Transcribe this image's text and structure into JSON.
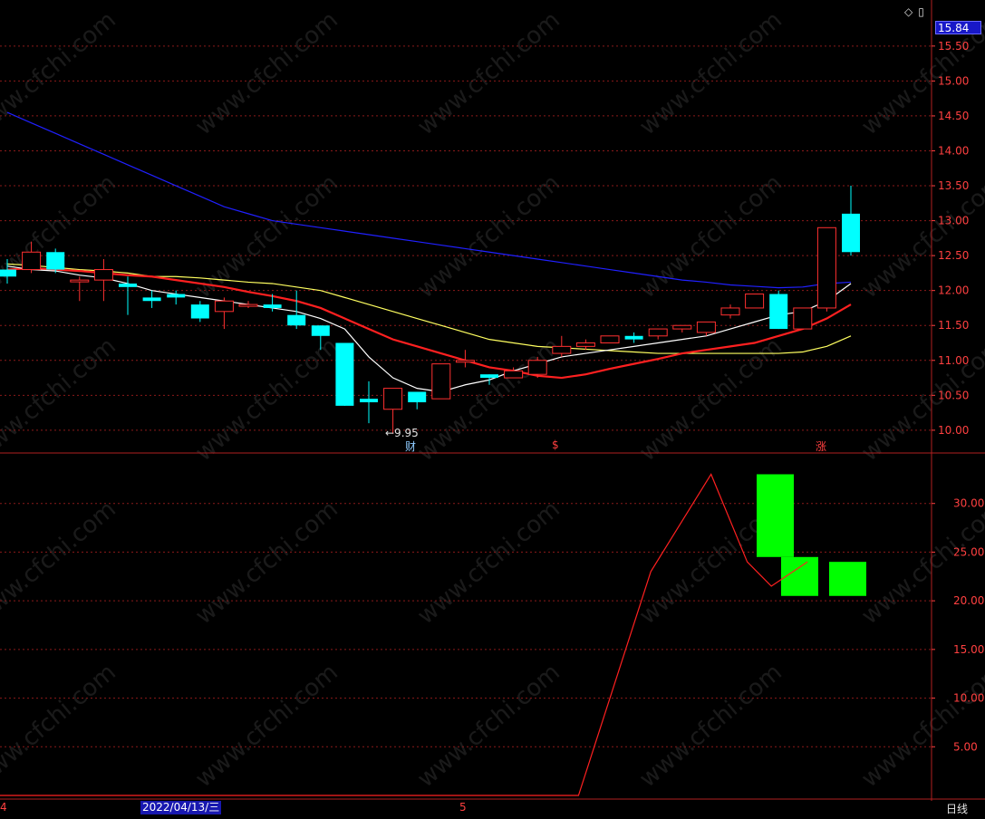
{
  "header": {
    "current_price": "15.84",
    "icons": [
      "diamond-icon",
      "window-restore-icon"
    ]
  },
  "footer": {
    "left_tick": "4",
    "date_badge": "2022/04/13/三",
    "mid_tick": "5",
    "period": "日线"
  },
  "events": {
    "cai": "财",
    "s": "$",
    "zhang": "涨"
  },
  "annotations": {
    "low_label": "←9.95"
  },
  "watermark": "www.cfchi.com",
  "colors": {
    "background": "#000000",
    "up": "#ff3030",
    "down": "#00ffff",
    "grid": "#8b1a1a",
    "ma5": "#ffffff",
    "ma10": "#ff2020",
    "ma20": "#ffff60",
    "ma60": "#2020ff",
    "volume_bar": "#00ff00",
    "volume_line": "#ff2020"
  },
  "chart_data": [
    {
      "type": "candlestick",
      "y_ticks": [
        "10.00",
        "10.50",
        "11.00",
        "11.50",
        "12.00",
        "12.50",
        "13.00",
        "13.50",
        "14.00",
        "14.50",
        "15.00",
        "15.50"
      ],
      "ylim": [
        9.7,
        15.9
      ],
      "candles": [
        {
          "o": 12.3,
          "c": 12.2,
          "h": 12.45,
          "l": 12.1
        },
        {
          "o": 12.3,
          "c": 12.55,
          "h": 12.7,
          "l": 12.25
        },
        {
          "o": 12.55,
          "c": 12.3,
          "h": 12.6,
          "l": 12.25
        },
        {
          "o": 12.15,
          "c": 12.15,
          "h": 12.2,
          "l": 11.85
        },
        {
          "o": 12.15,
          "c": 12.3,
          "h": 12.45,
          "l": 11.85
        },
        {
          "o": 12.1,
          "c": 12.05,
          "h": 12.2,
          "l": 11.65
        },
        {
          "o": 11.9,
          "c": 11.85,
          "h": 12.0,
          "l": 11.75
        },
        {
          "o": 11.95,
          "c": 11.9,
          "h": 12.0,
          "l": 11.8
        },
        {
          "o": 11.8,
          "c": 11.6,
          "h": 11.85,
          "l": 11.55
        },
        {
          "o": 11.7,
          "c": 11.85,
          "h": 11.9,
          "l": 11.45
        },
        {
          "o": 11.8,
          "c": 11.8,
          "h": 11.85,
          "l": 11.75
        },
        {
          "o": 11.8,
          "c": 11.75,
          "h": 11.95,
          "l": 11.7
        },
        {
          "o": 11.65,
          "c": 11.5,
          "h": 12.0,
          "l": 11.45
        },
        {
          "o": 11.5,
          "c": 11.35,
          "h": 11.5,
          "l": 11.15
        },
        {
          "o": 11.25,
          "c": 10.35,
          "h": 11.25,
          "l": 10.35
        },
        {
          "o": 10.45,
          "c": 10.4,
          "h": 10.7,
          "l": 10.1
        },
        {
          "o": 10.3,
          "c": 10.6,
          "h": 10.6,
          "l": 9.95
        },
        {
          "o": 10.55,
          "c": 10.4,
          "h": 10.55,
          "l": 10.3
        },
        {
          "o": 10.45,
          "c": 10.95,
          "h": 10.95,
          "l": 10.45
        },
        {
          "o": 11.0,
          "c": 11.0,
          "h": 11.15,
          "l": 10.9
        },
        {
          "o": 10.8,
          "c": 10.75,
          "h": 10.8,
          "l": 10.65
        },
        {
          "o": 10.75,
          "c": 10.85,
          "h": 10.9,
          "l": 10.75
        },
        {
          "o": 10.8,
          "c": 11.0,
          "h": 11.05,
          "l": 10.75
        },
        {
          "o": 11.1,
          "c": 11.2,
          "h": 11.35,
          "l": 11.05
        },
        {
          "o": 11.2,
          "c": 11.25,
          "h": 11.3,
          "l": 11.15
        },
        {
          "o": 11.25,
          "c": 11.35,
          "h": 11.35,
          "l": 11.25
        },
        {
          "o": 11.35,
          "c": 11.3,
          "h": 11.4,
          "l": 11.25
        },
        {
          "o": 11.35,
          "c": 11.45,
          "h": 11.45,
          "l": 11.3
        },
        {
          "o": 11.45,
          "c": 11.5,
          "h": 11.5,
          "l": 11.4
        },
        {
          "o": 11.4,
          "c": 11.55,
          "h": 11.55,
          "l": 11.35
        },
        {
          "o": 11.65,
          "c": 11.75,
          "h": 11.8,
          "l": 11.6
        },
        {
          "o": 11.75,
          "c": 11.95,
          "h": 11.95,
          "l": 11.75
        },
        {
          "o": 11.95,
          "c": 11.45,
          "h": 12.0,
          "l": 11.45
        },
        {
          "o": 11.45,
          "c": 11.75,
          "h": 11.75,
          "l": 11.45
        },
        {
          "o": 11.75,
          "c": 12.9,
          "h": 12.9,
          "l": 11.7
        },
        {
          "o": 13.1,
          "c": 12.55,
          "h": 13.5,
          "l": 12.5
        }
      ],
      "ma": {
        "ma5": [
          12.35,
          12.3,
          12.28,
          12.22,
          12.18,
          12.1,
          12.0,
          11.95,
          11.9,
          11.85,
          11.8,
          11.75,
          11.7,
          11.6,
          11.45,
          11.05,
          10.75,
          10.6,
          10.55,
          10.65,
          10.72,
          10.85,
          10.95,
          11.05,
          11.1,
          11.15,
          11.2,
          11.25,
          11.3,
          11.35,
          11.45,
          11.55,
          11.65,
          11.7,
          11.85,
          12.1
        ],
        "ma10": [
          12.3,
          12.32,
          12.3,
          12.28,
          12.25,
          12.22,
          12.2,
          12.15,
          12.1,
          12.05,
          11.98,
          11.92,
          11.85,
          11.75,
          11.6,
          11.45,
          11.3,
          11.2,
          11.1,
          11.0,
          10.9,
          10.85,
          10.78,
          10.75,
          10.8,
          10.88,
          10.95,
          11.02,
          11.1,
          11.15,
          11.2,
          11.25,
          11.35,
          11.45,
          11.6,
          11.8
        ],
        "ma20": [
          12.38,
          12.36,
          12.33,
          12.3,
          12.28,
          12.25,
          12.2,
          12.2,
          12.18,
          12.15,
          12.12,
          12.1,
          12.05,
          12.0,
          11.9,
          11.8,
          11.7,
          11.6,
          11.5,
          11.4,
          11.3,
          11.25,
          11.2,
          11.18,
          11.16,
          11.14,
          11.12,
          11.1,
          11.1,
          11.1,
          11.1,
          11.1,
          11.1,
          11.12,
          11.2,
          11.35
        ],
        "ma60": [
          14.55,
          14.4,
          14.25,
          14.1,
          13.95,
          13.8,
          13.65,
          13.5,
          13.35,
          13.2,
          13.1,
          13.0,
          12.95,
          12.9,
          12.85,
          12.8,
          12.75,
          12.7,
          12.65,
          12.6,
          12.55,
          12.5,
          12.45,
          12.4,
          12.35,
          12.3,
          12.25,
          12.2,
          12.15,
          12.12,
          12.08,
          12.06,
          12.04,
          12.05,
          12.1,
          12.12
        ]
      }
    },
    {
      "type": "bar",
      "y_ticks": [
        "5.00",
        "10.00",
        "15.00",
        "20.00",
        "25.00",
        "30.00"
      ],
      "ylim": [
        0,
        35
      ],
      "bars": [
        {
          "lo": 24.5,
          "hi": 33.0
        },
        {
          "lo": 20.5,
          "hi": 24.5
        },
        {
          "lo": 20.5,
          "hi": 24.0
        }
      ],
      "line_points": [
        {
          "x": 0,
          "y": 0.0
        },
        {
          "x": 24,
          "y": 0.0
        },
        {
          "x": 27,
          "y": 23.0
        },
        {
          "x": 29.5,
          "y": 33.0
        },
        {
          "x": 31,
          "y": 24.0
        },
        {
          "x": 32,
          "y": 21.5
        },
        {
          "x": 33.5,
          "y": 24.0
        }
      ]
    }
  ]
}
